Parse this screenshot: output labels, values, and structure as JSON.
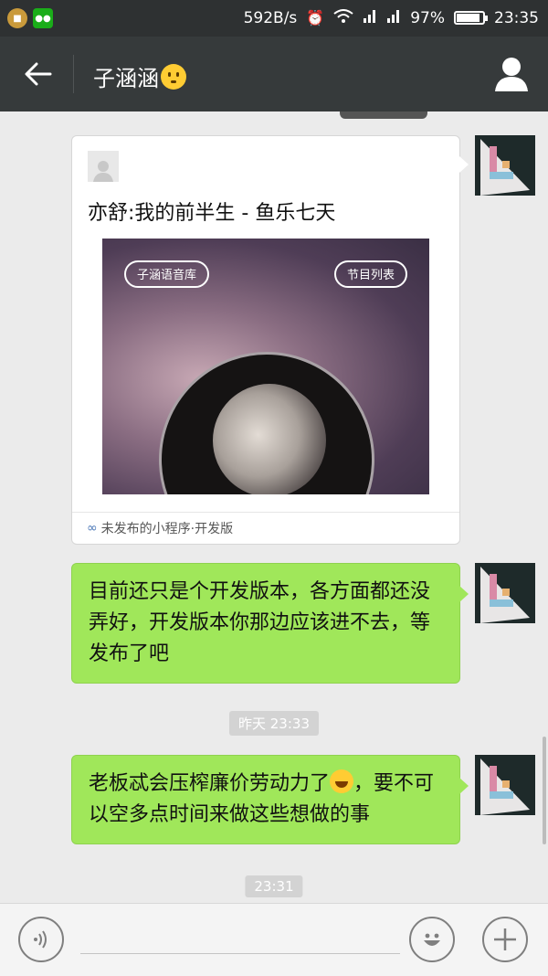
{
  "status_bar": {
    "net_speed": "592B/s",
    "battery": "97%",
    "battery_level": 0.97,
    "time": "23:35",
    "icons": [
      "app-notification-icon",
      "wechat-icon",
      "alarm-icon",
      "wifi-icon",
      "signal-icon",
      "signal-icon",
      "battery-icon"
    ]
  },
  "header": {
    "title": "子涵涵",
    "back_icon": "back-arrow-icon",
    "profile_icon": "person-icon"
  },
  "messages": {
    "card": {
      "title": "亦舒:我的前半生 - 鱼乐七天",
      "pill_left": "子涵语音库",
      "pill_right": "节目列表",
      "footer": "未发布的小程序·开发版"
    },
    "msg1": "目前还只是个开发版本，各方面都还没弄好，开发版本你那边应该进不去，等发布了吧",
    "time1": "昨天 23:33",
    "msg2_part1": "老板忒会压榨廉价劳动力了",
    "msg2_part2": "，要不可以空多点时间来做这些想做的事",
    "time2": "23:31"
  },
  "input_bar": {
    "voice_icon": "voice-icon",
    "emoji_icon": "emoji-icon",
    "plus_icon": "plus-icon",
    "placeholder": ""
  }
}
